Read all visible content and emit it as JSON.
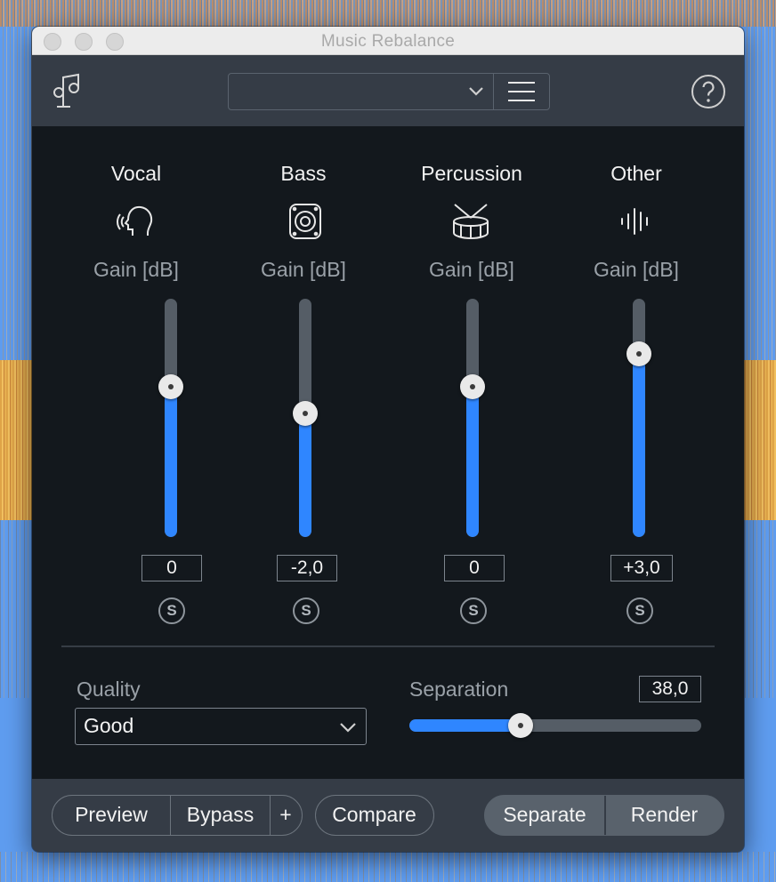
{
  "window": {
    "title": "Music Rebalance"
  },
  "toolbar": {
    "module_icon": "music-note-stand-icon",
    "preset_value": "",
    "menu_icon": "hamburger-menu-icon",
    "help_icon": "question-circle-icon"
  },
  "sources": [
    {
      "name": "Vocal",
      "icon": "vocal-head-icon",
      "gain_label": "Gain [dB]",
      "value": "0",
      "solo": "S",
      "level": 0.63
    },
    {
      "name": "Bass",
      "icon": "speaker-icon",
      "gain_label": "Gain [dB]",
      "value": "-2,0",
      "solo": "S",
      "level": 0.52
    },
    {
      "name": "Percussion",
      "icon": "drum-icon",
      "gain_label": "Gain [dB]",
      "value": "0",
      "solo": "S",
      "level": 0.63
    },
    {
      "name": "Other",
      "icon": "waveform-icon",
      "gain_label": "Gain [dB]",
      "value": "+3,0",
      "solo": "S",
      "level": 0.77
    }
  ],
  "quality": {
    "label": "Quality",
    "value": "Good"
  },
  "separation": {
    "label": "Separation",
    "value": "38,0",
    "level": 0.38
  },
  "footer": {
    "preview": "Preview",
    "bypass": "Bypass",
    "plus": "+",
    "compare": "Compare",
    "separate": "Separate",
    "render": "Render"
  },
  "colors": {
    "accent": "#2f86ff",
    "panel": "#13181d",
    "chrome": "#353c46"
  }
}
